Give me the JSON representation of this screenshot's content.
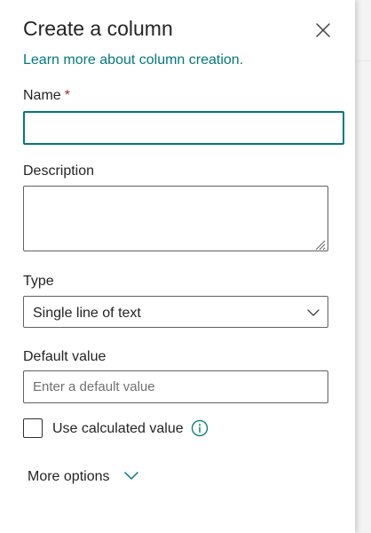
{
  "panel": {
    "title": "Create a column",
    "learn_more_link": "Learn more about column creation."
  },
  "fields": {
    "name": {
      "label": "Name",
      "required_marker": "*",
      "value": ""
    },
    "description": {
      "label": "Description",
      "value": ""
    },
    "type": {
      "label": "Type",
      "selected": "Single line of text"
    },
    "default_value": {
      "label": "Default value",
      "placeholder": "Enter a default value",
      "value": ""
    },
    "use_calculated": {
      "label": "Use calculated value",
      "checked": false
    }
  },
  "more_options": {
    "label": "More options"
  },
  "icons": {
    "close": "close-icon",
    "dropdown": "chevron-down-icon",
    "info": "info-icon",
    "more": "chevron-down-icon"
  },
  "colors": {
    "accent": "#03787c",
    "required": "#a4262c",
    "text": "#242424",
    "border": "#616161"
  }
}
